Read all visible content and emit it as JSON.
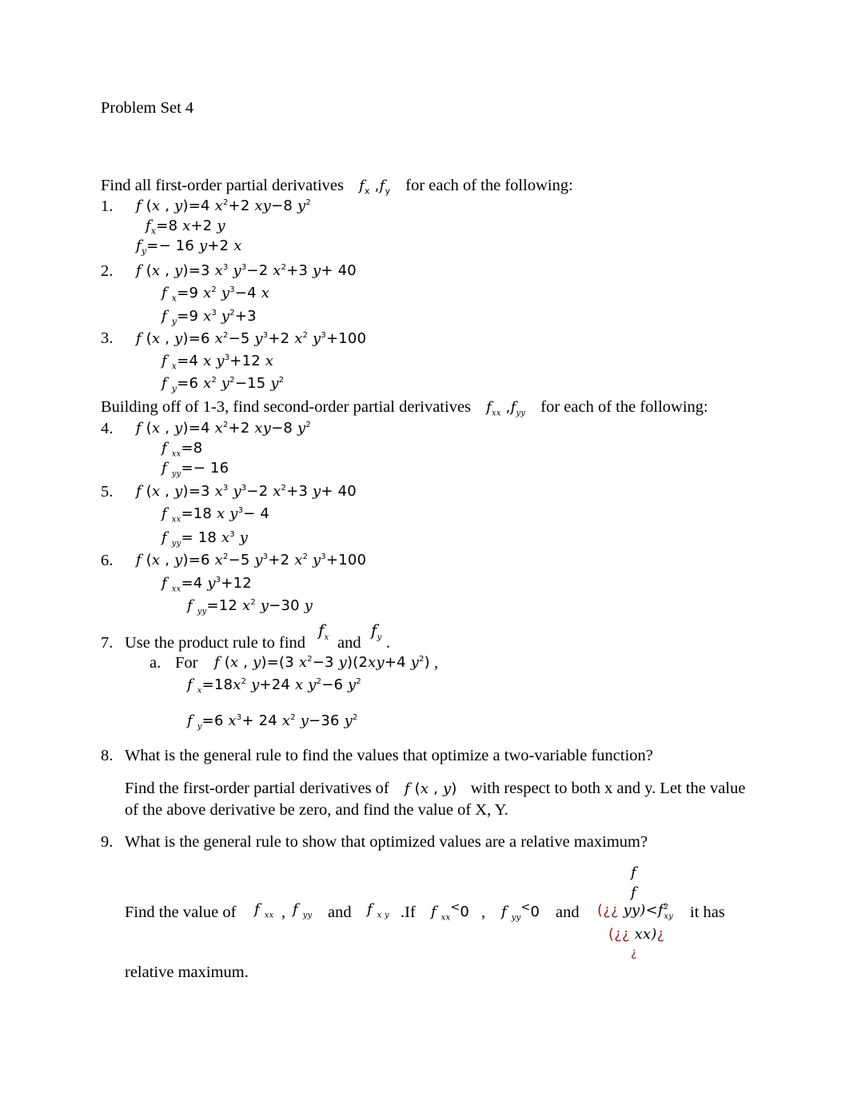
{
  "document": {
    "title": "Problem Set 4",
    "section1_intro_pre": "Find all first-order partial derivatives",
    "section1_intro_sym": "f ₓ ,f ᵧ",
    "section1_intro_post": "for each of the following:",
    "section2_intro_pre": "Building off of 1-3, find second-order partial derivatives",
    "section2_intro_sym": "f ₓₓ ,f ᵧᵧ",
    "section2_intro_post": "for each of the following:",
    "problems": [
      {
        "number": "1.",
        "function": "f (x , y) = 4 x² + 2 xy − 8 y²",
        "answers": [
          "f ₓ = 8 x + 2 y",
          "f ᵧ = − 16 y + 2 x"
        ]
      },
      {
        "number": "2.",
        "function": "f (x , y) = 3 x³ y³ − 2 x² + 3 y + 40",
        "answers": [
          "f ₓ = 9 x² y³ − 4 x",
          "f ᵧ = 9 x³ y² + 3"
        ]
      },
      {
        "number": "3.",
        "function": "f (x , y) = 6 x² − 5 y³ + 2 x² y³ + 100",
        "answers": [
          "f ₓ = 4 x y³ + 12 x",
          "f ᵧ = 6 x² y² − 15 y²"
        ]
      },
      {
        "number": "4.",
        "function": "f (x , y) = 4 x² + 2 xy − 8 y²",
        "answers": [
          "f ₓₓ = 8",
          "f ᵧᵧ = − 16"
        ]
      },
      {
        "number": "5.",
        "function": "f (x , y) = 3 x³ y³ − 2 x² + 3 y + 40",
        "answers": [
          "f ₓₓ = 18 x y³ − 4",
          "f ᵧᵧ = 18 x³ y"
        ]
      },
      {
        "number": "6.",
        "function": "f (x , y) = 6 x² − 5 y³ + 2 x² y³ + 100",
        "answers": [
          "f ₓₓ = 4 y³ + 12",
          "f ᵧᵧ = 12 x² y − 30 y"
        ]
      }
    ],
    "q7": {
      "number": "7.",
      "text_pre": "Use the product rule to find",
      "sym1": "f ₓ",
      "and": "and",
      "sym2": "f ᵧ",
      "end": ".",
      "sub_label": "a.",
      "sub_for": "For",
      "function": "f (x , y) = (3 x² − 3 y)(2xy + 4 y²)",
      "comma": ",",
      "answers": [
        "f ₓ = 18x² y + 24 x y² − 6 y²",
        "f ᵧ = 6 x³ + 24 x² y − 36 y²"
      ]
    },
    "q8": {
      "number": "8.",
      "question": "What is the general rule to find the values that optimize a two-variable function?",
      "answer_pre": "Find the first-order partial derivatives of",
      "answer_sym": "f (x , y)",
      "answer_post": "with respect to both x and y. Let the value",
      "answer_line2": "of the above derivative be zero, and find the value of X, Y."
    },
    "q9": {
      "number": "9.",
      "question": "What is the general rule to show that optimized values are a relative maximum?",
      "answer_pre": "Find the value of",
      "sym_fxx": "f ₓₓ",
      "comma1": ",",
      "sym_fyy": "f ᵧᵧ",
      "and1": "and",
      "sym_fxy": "f ₓ ᵧ",
      "if": ".If",
      "cond1": "f ₓₓ < 0",
      "comma2": ",",
      "cond2": "f ᵧᵧ < 0",
      "and2": "and",
      "garbled_formula": {
        "line_f1": "f",
        "line_f2": "f",
        "line3_open": "(¿¿",
        "line3_mid": "yy)<f",
        "line3_sup": "2",
        "line3_sub": "xy",
        "line4_open": "(¿¿",
        "line4_mid": "xx)",
        "line4_close": "¿",
        "line5": "¿"
      },
      "answer_post": "it has",
      "answer_line2": "relative maximum."
    }
  }
}
